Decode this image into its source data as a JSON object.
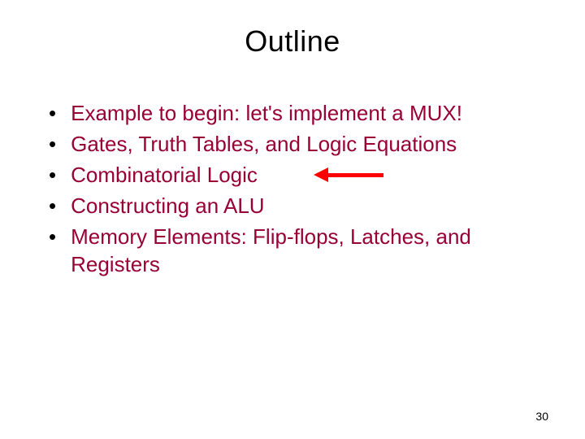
{
  "title": "Outline",
  "bullets": [
    "Example to begin: let's implement a MUX!",
    "Gates, Truth Tables, and Logic Equations",
    "Combinatorial Logic",
    "Constructing an ALU",
    "Memory Elements:  Flip-flops, Latches, and Registers"
  ],
  "arrow_target_index": 2,
  "page_number": "30"
}
